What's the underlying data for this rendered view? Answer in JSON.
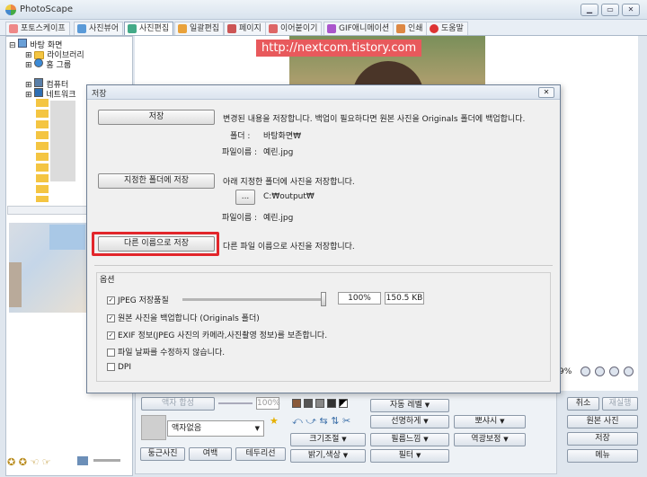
{
  "app": {
    "title": "PhotoScape"
  },
  "tabs": [
    "포토스케이프",
    "사진뷰어",
    "사진편집",
    "일괄편집",
    "페이지",
    "이어붙이기",
    "GIF애니메이션",
    "인쇄",
    "도움말"
  ],
  "tree": {
    "root": "바탕 화면",
    "items": [
      "라이브러리",
      "홈 그룹",
      "컴퓨터",
      "네트워크"
    ]
  },
  "watermark": "http://nextcom.tistory.com",
  "dialog": {
    "title": "저장",
    "save_button": "저장",
    "save_desc": "변경된 내용을 저장합니다. 백업이 필요하다면 원본 사진을 Originals 폴더에 백업합니다.",
    "folder_label": "폴더 :",
    "folder_value": "바탕화면₩",
    "filename_label": "파일이름 :",
    "filename_value": "예린.jpg",
    "save_folder_button": "지정한 폴더에 저장",
    "save_folder_desc": "아래 지정한 폴더에 사진을 저장합니다.",
    "browse_button": "...",
    "output_path": "C:₩output₩",
    "filename_label2": "파일이름 :",
    "filename_value2": "예린.jpg",
    "save_as_button": "다른 이름으로 저장",
    "save_as_desc": "다른 파일 이름으로 사진을 저장합니다.",
    "options_title": "옵션",
    "jpeg_quality_label": "JPEG 저장품질",
    "jpeg_quality_percent": "100%",
    "jpeg_quality_value": 100,
    "file_size": "150.5 KB",
    "options": [
      {
        "label": "원본 사진을 백업합니다 (Originals 폴더)",
        "checked": true
      },
      {
        "label": "EXIF 정보(JPEG 사진의 카메라,사진촬영 정보)를 보존합니다.",
        "checked": true
      },
      {
        "label": "파일 날짜를 수정하지 않습니다.",
        "checked": false
      },
      {
        "label": "DPI",
        "checked": false
      }
    ]
  },
  "bottom": {
    "frame_combine": "액자 합성",
    "zoom_value": "100%",
    "frame_select": "액자없음",
    "round_photo": "둥근사진",
    "margin": "여백",
    "border": "테두리선",
    "auto_level": "자동 레벨",
    "sharpen": "선명하게",
    "vignette": "뽀샤시",
    "resize": "크기조절",
    "film": "필름느낌",
    "backlight": "역광보정",
    "brightness": "밝기,색상",
    "filter": "필터",
    "cancel": "취소",
    "redo": "재실행",
    "original": "원본 사진",
    "save": "저장",
    "menu": "메뉴",
    "zoom_pct": "9%"
  },
  "colors": {
    "highlight": "#e2262b",
    "watermark_bg": "#e8595c"
  }
}
